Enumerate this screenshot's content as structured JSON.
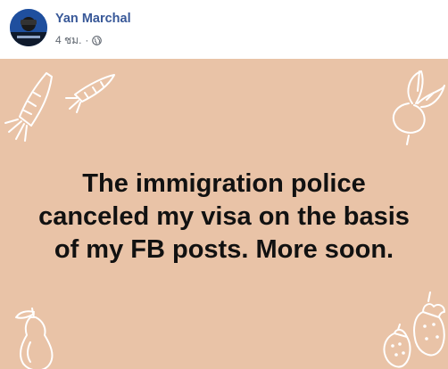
{
  "post": {
    "author": "Yan Marchal",
    "timestamp": "4 ชม.",
    "separator": "·",
    "privacy_icon": "globe-icon",
    "text": "The immigration police canceled my visa on the basis of my FB posts. More soon.",
    "background_color": "#e9c3a7",
    "decoration_icons": [
      "carrot-icon",
      "carrot-icon",
      "beet-icon",
      "pear-icon",
      "strawberry-icon",
      "strawberry-icon"
    ]
  },
  "colors": {
    "author_link": "#385898",
    "meta_text": "#606770",
    "post_text": "#111111"
  }
}
